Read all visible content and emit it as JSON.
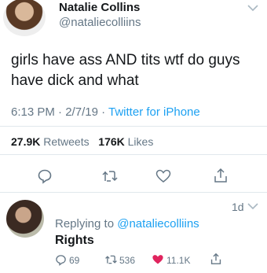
{
  "tweet": {
    "author_name": "Natalie Collins",
    "author_handle": "@nataliecolliins",
    "text": "girls have ass AND tits wtf do guys have dick and what",
    "time": "6:13 PM",
    "date": "2/7/19",
    "separator": "·",
    "source": "Twitter for iPhone",
    "retweets_count": "27.9K",
    "retweets_label": "Retweets",
    "likes_count": "176K",
    "likes_label": "Likes"
  },
  "reply": {
    "age": "1d",
    "replying_prefix": "Replying to",
    "replying_to": "@nataliecolliins",
    "text": "Rights",
    "reply_count": "69",
    "retweet_count": "536",
    "like_count": "11.1K"
  },
  "icons": [
    "reply-icon",
    "retweet-icon",
    "like-icon",
    "share-icon",
    "chevron-down-icon"
  ],
  "colors": {
    "accent": "#1da1f2",
    "secondary_text": "#657786",
    "like": "#e0245e",
    "divider": "#e1e8ed"
  }
}
